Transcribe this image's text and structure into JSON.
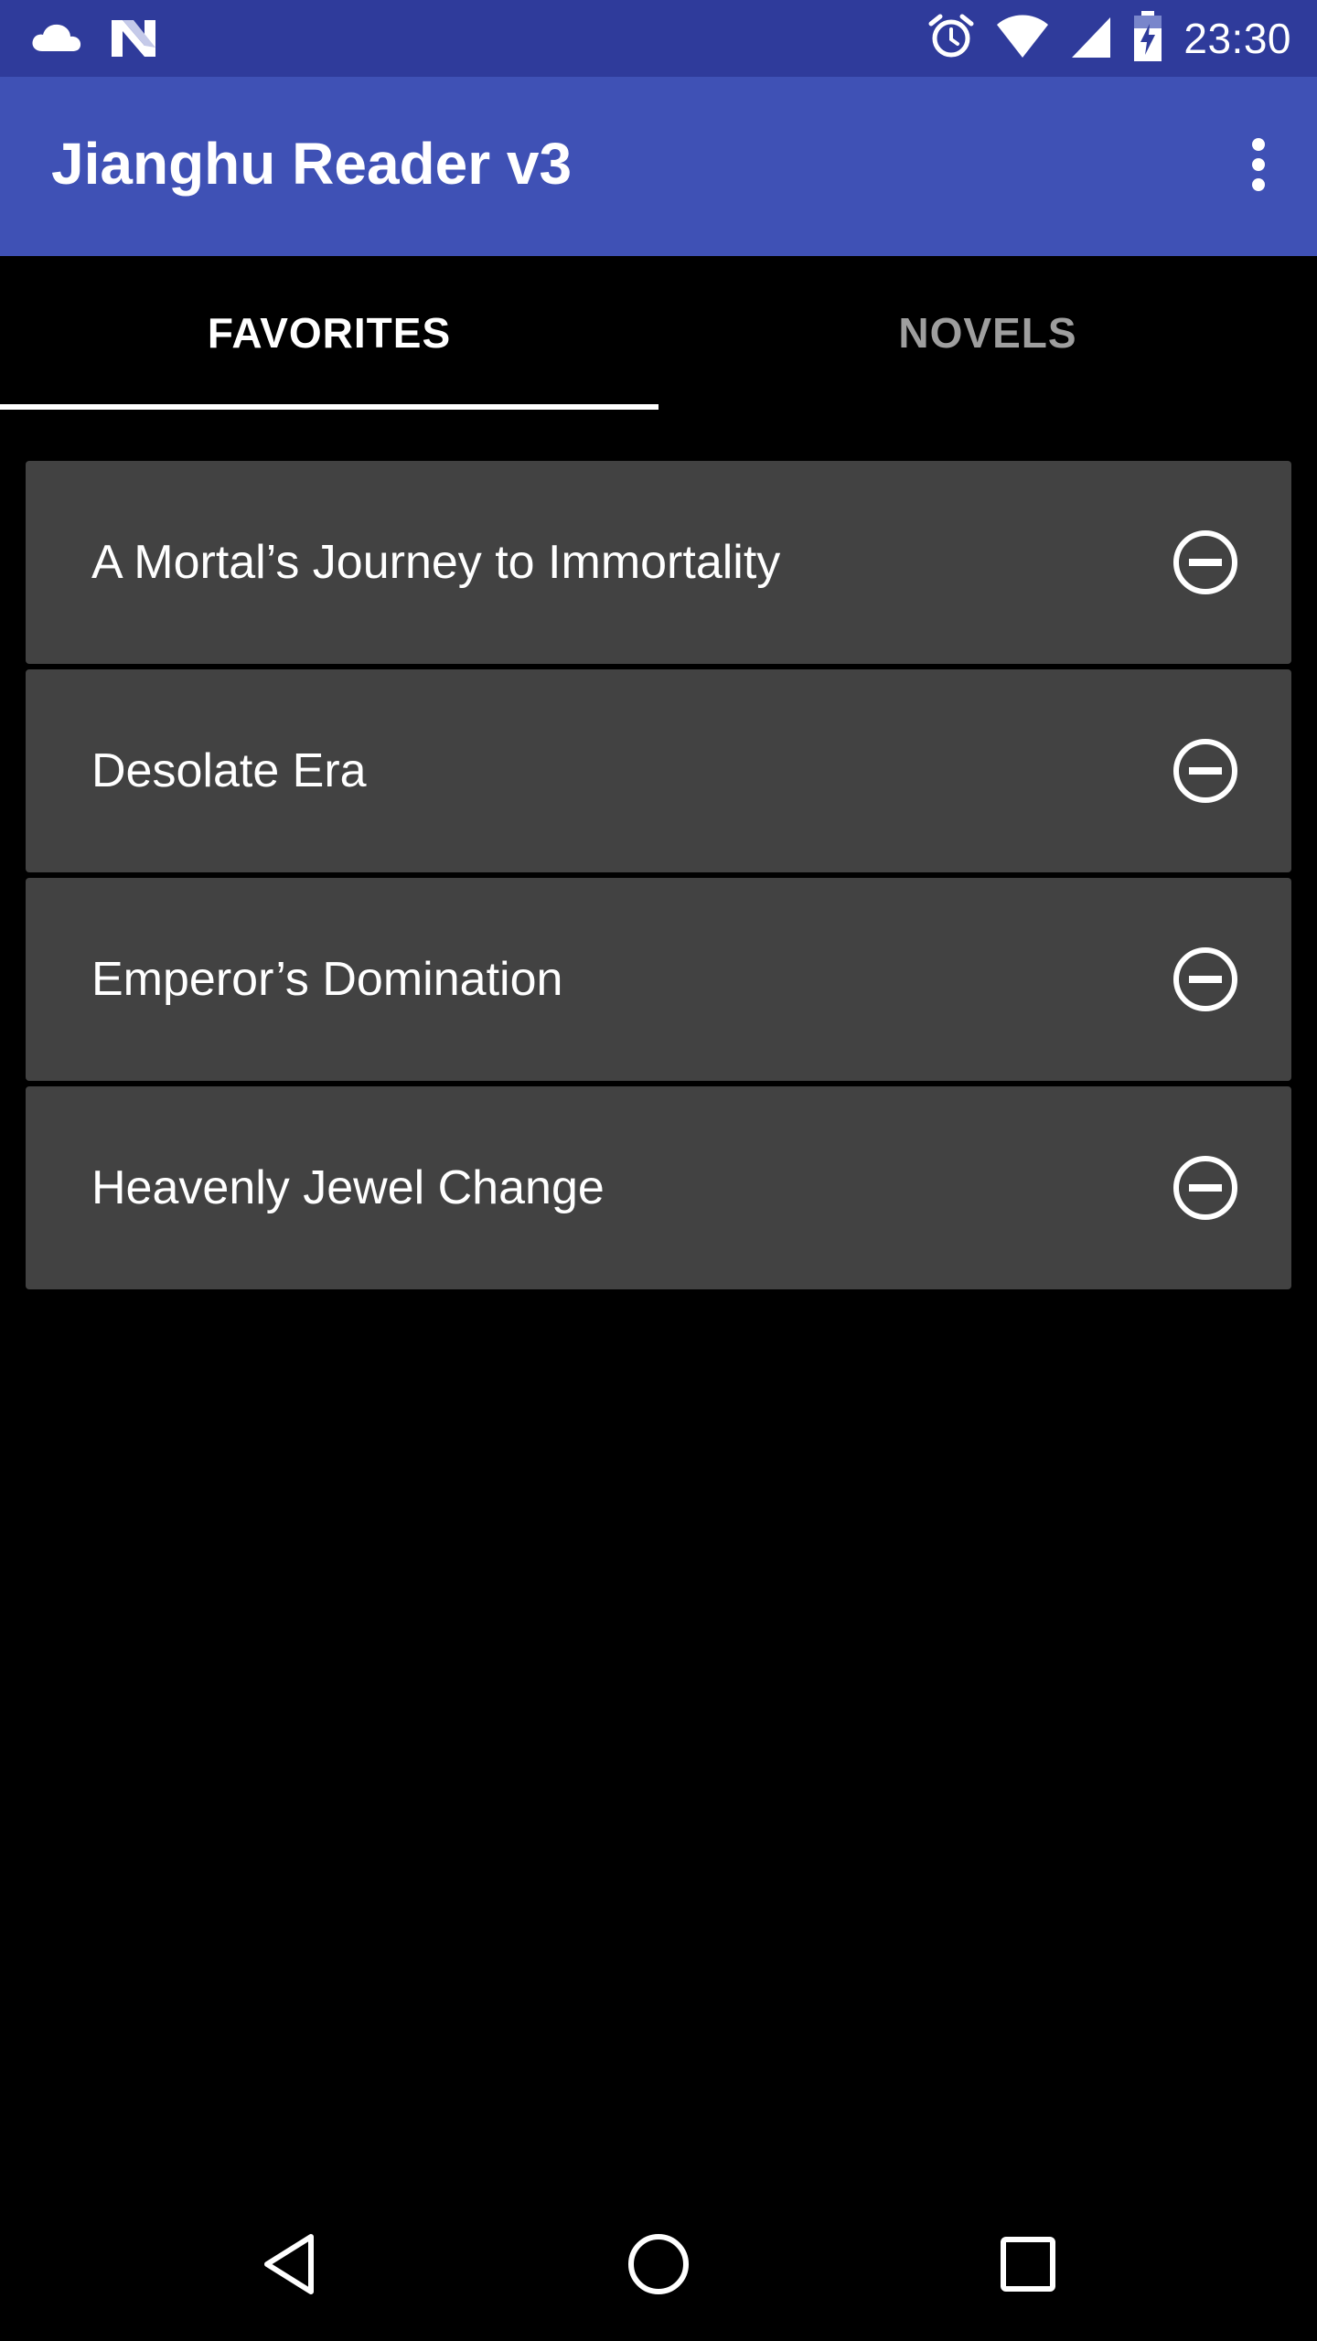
{
  "status_bar": {
    "time": "23:30",
    "left_icons": [
      "cloud-icon",
      "n-notification-icon"
    ],
    "right_icons": [
      "alarm-icon",
      "wifi-icon",
      "signal-icon",
      "battery-charging-icon"
    ]
  },
  "app_bar": {
    "title": "Jianghu Reader v3",
    "overflow_icon": "more-vert-icon"
  },
  "tabs": [
    {
      "label": "FAVORITES",
      "selected": true
    },
    {
      "label": "NOVELS",
      "selected": false
    }
  ],
  "favorites": [
    {
      "title": "A Mortal’s Journey to Immortality",
      "action_icon": "remove-circle-icon"
    },
    {
      "title": "Desolate Era",
      "action_icon": "remove-circle-icon"
    },
    {
      "title": "Emperor’s Domination",
      "action_icon": "remove-circle-icon"
    },
    {
      "title": "Heavenly Jewel Change",
      "action_icon": "remove-circle-icon"
    }
  ],
  "nav_bar": {
    "buttons": [
      "back-icon",
      "home-icon",
      "recents-icon"
    ]
  },
  "colors": {
    "status_bar": "#2f3b9b",
    "app_bar": "#3f51b5",
    "background": "#000000",
    "card": "#424242",
    "tab_inactive": "#9e9e9e"
  }
}
